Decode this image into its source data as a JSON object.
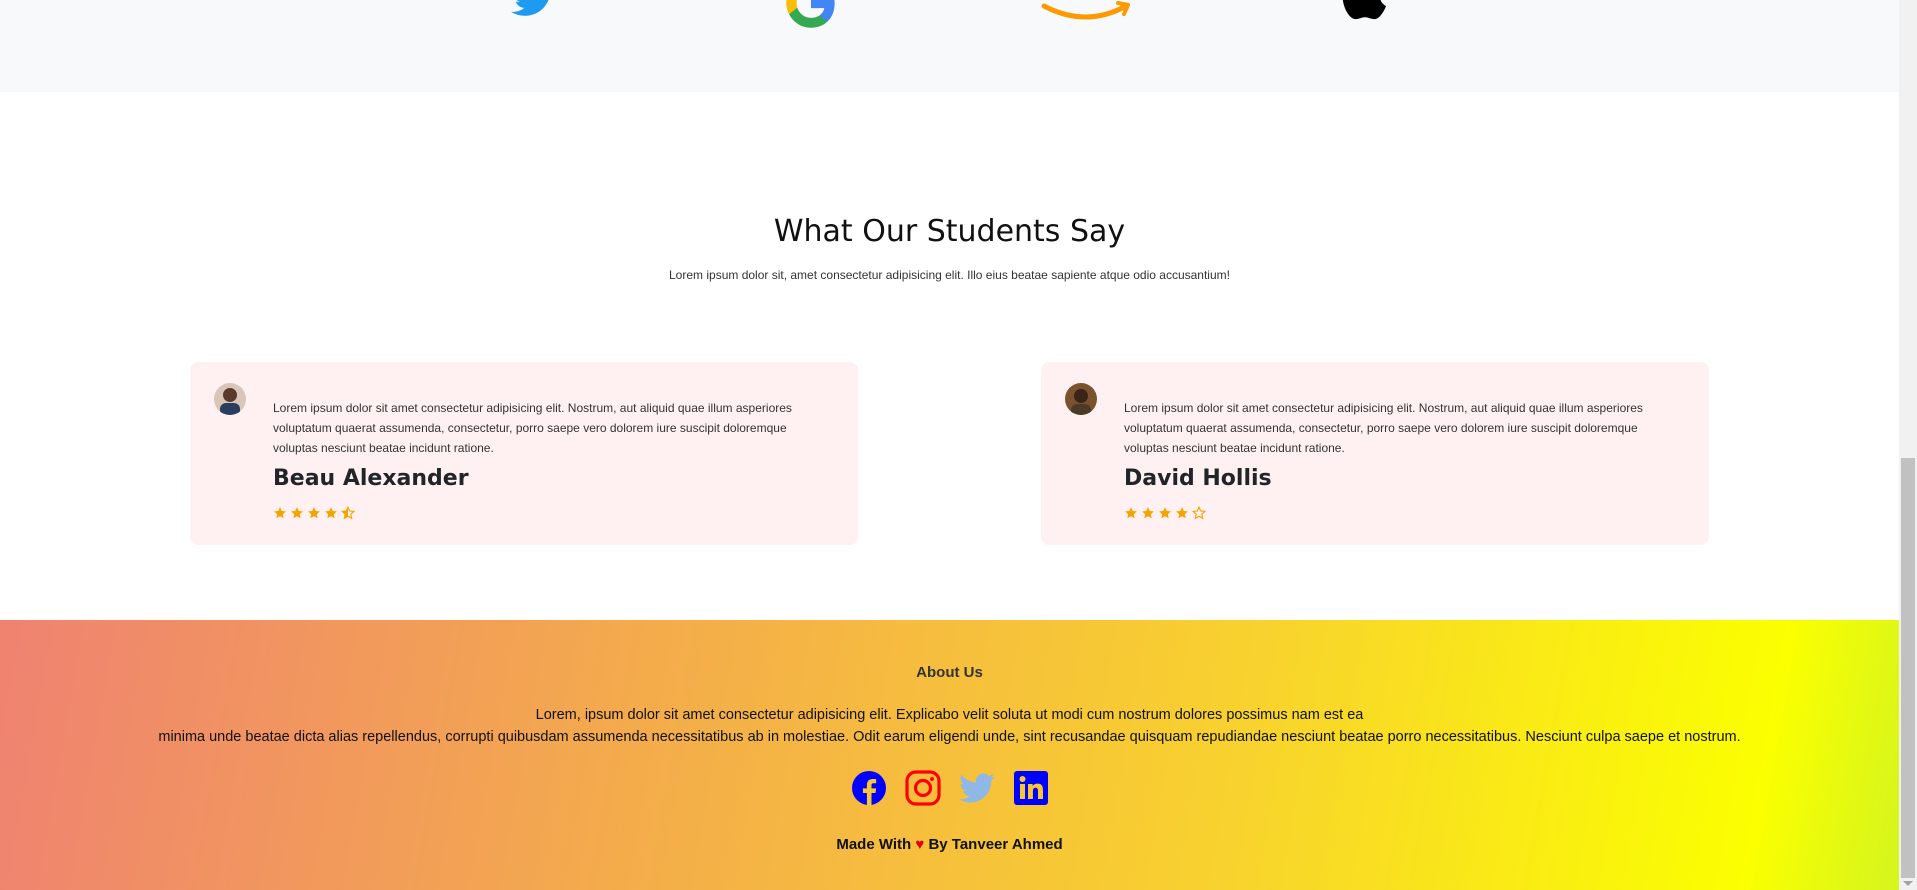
{
  "logos": [
    "twitter-logo",
    "google-logo",
    "amazon-logo",
    "apple-logo"
  ],
  "testimonials": {
    "title": "What Our Students Say",
    "subtitle": "Lorem ipsum dolor sit, amet consectetur adipisicing elit. Illo eius beatae sapiente atque odio accusantium!",
    "cards": [
      {
        "quote": "Lorem ipsum dolor sit amet consectetur adipisicing elit. Nostrum, aut aliquid quae illum asperiores voluptatum quaerat assumenda, consectetur, porro saepe vero dolorem iure suscipit doloremque voluptas nesciunt beatae incidunt ratione.",
        "name": "Beau Alexander",
        "rating": 4.5
      },
      {
        "quote": "Lorem ipsum dolor sit amet consectetur adipisicing elit. Nostrum, aut aliquid quae illum asperiores voluptatum quaerat assumenda, consectetur, porro saepe vero dolorem iure suscipit doloremque voluptas nesciunt beatae incidunt ratione.",
        "name": "David Hollis",
        "rating": 4
      }
    ]
  },
  "footer": {
    "about_title": "About Us",
    "about_line1": "Lorem, ipsum dolor sit amet consectetur adipisicing elit. Explicabo velit soluta ut modi cum nostrum dolores possimus nam est ea",
    "about_line2": "minima unde beatae dicta alias repellendus, corrupti quibusdam assumenda necessitatibus ab in molestiae. Odit earum eligendi unde, sint recusandae quisquam repudiandae nesciunt beatae porro necessitatibus. Nesciunt culpa saepe et nostrum.",
    "socials": [
      "facebook-icon",
      "instagram-icon",
      "twitter-icon",
      "linkedin-icon"
    ],
    "made_prefix": "Made With",
    "heart": "♥",
    "made_suffix": "By Tanveer Ahmed"
  },
  "colors": {
    "star": "#f5a300",
    "social_blue": "#0000ff",
    "instagram_red": "#ff0000",
    "twitter_light": "#8fb8e6"
  }
}
